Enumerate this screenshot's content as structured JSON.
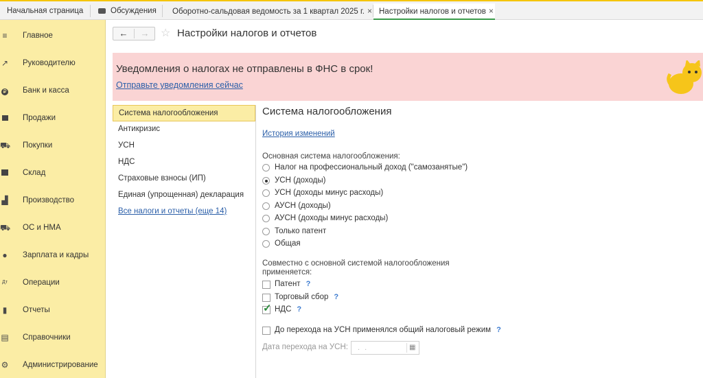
{
  "tabs": [
    {
      "label": "Начальная страница"
    },
    {
      "label": "Обсуждения"
    },
    {
      "label": "Оборотно-сальдовая ведомость за 1 квартал 2025 г.",
      "close": "×"
    },
    {
      "label": "Настройки налогов и отчетов",
      "close": "×"
    }
  ],
  "sidebar": {
    "items": [
      {
        "label": "Главное",
        "icon": "menu-icon"
      },
      {
        "label": "Руководителю",
        "icon": "trend-icon"
      },
      {
        "label": "Банк и касса",
        "icon": "coin-icon"
      },
      {
        "label": "Продажи",
        "icon": "bag-icon"
      },
      {
        "label": "Покупки",
        "icon": "cart-icon"
      },
      {
        "label": "Склад",
        "icon": "warehouse-icon"
      },
      {
        "label": "Производство",
        "icon": "factory-icon"
      },
      {
        "label": "ОС и НМА",
        "icon": "truck-icon"
      },
      {
        "label": "Зарплата и кадры",
        "icon": "person-icon"
      },
      {
        "label": "Операции",
        "icon": "dt-kt-icon"
      },
      {
        "label": "Отчеты",
        "icon": "bar-chart-icon"
      },
      {
        "label": "Справочники",
        "icon": "book-icon"
      },
      {
        "label": "Администрирование",
        "icon": "gear-icon"
      }
    ]
  },
  "header": {
    "title": "Настройки налогов и отчетов",
    "back": "←",
    "forward": "→",
    "star": "☆"
  },
  "banner": {
    "heading": "Уведомления о налогах не отправлены в ФНС в срок!",
    "link": "Отправьте уведомления сейчас",
    "accent": "#fad4d4"
  },
  "leftnav": {
    "items": [
      {
        "label": "Система налогообложения"
      },
      {
        "label": "Антикризис"
      },
      {
        "label": "УСН"
      },
      {
        "label": "НДС"
      },
      {
        "label": "Страховые взносы (ИП)"
      },
      {
        "label": "Единая (упрощенная) декларация"
      },
      {
        "label": "Все налоги и отчеты (еще 14)"
      }
    ]
  },
  "content": {
    "title": "Система налогообложения",
    "history_link": "История изменений",
    "main_label": "Основная система налогообложения:",
    "options": [
      {
        "label": "Налог на профессиональный доход (\"самозанятые\")",
        "selected": false
      },
      {
        "label": "УСН (доходы)",
        "selected": true
      },
      {
        "label": "УСН (доходы минус расходы)",
        "selected": false
      },
      {
        "label": "АУСН (доходы)",
        "selected": false
      },
      {
        "label": "АУСН (доходы минус расходы)",
        "selected": false
      },
      {
        "label": "Только патент",
        "selected": false
      },
      {
        "label": "Общая",
        "selected": false
      }
    ],
    "combined_label_1": "Совместно с основной системой налогообложения",
    "combined_label_2": "применяется:",
    "checks": [
      {
        "label": "Патент",
        "checked": false,
        "help": "?"
      },
      {
        "label": "Торговый сбор",
        "checked": false,
        "help": "?"
      },
      {
        "label": "НДС",
        "checked": true,
        "help": "?"
      }
    ],
    "transition_check": {
      "label": "До перехода на УСН применялся общий налоговый режим",
      "checked": false,
      "help": "?"
    },
    "date_label": "Дата перехода на УСН:",
    "date_placeholder": ". ."
  }
}
